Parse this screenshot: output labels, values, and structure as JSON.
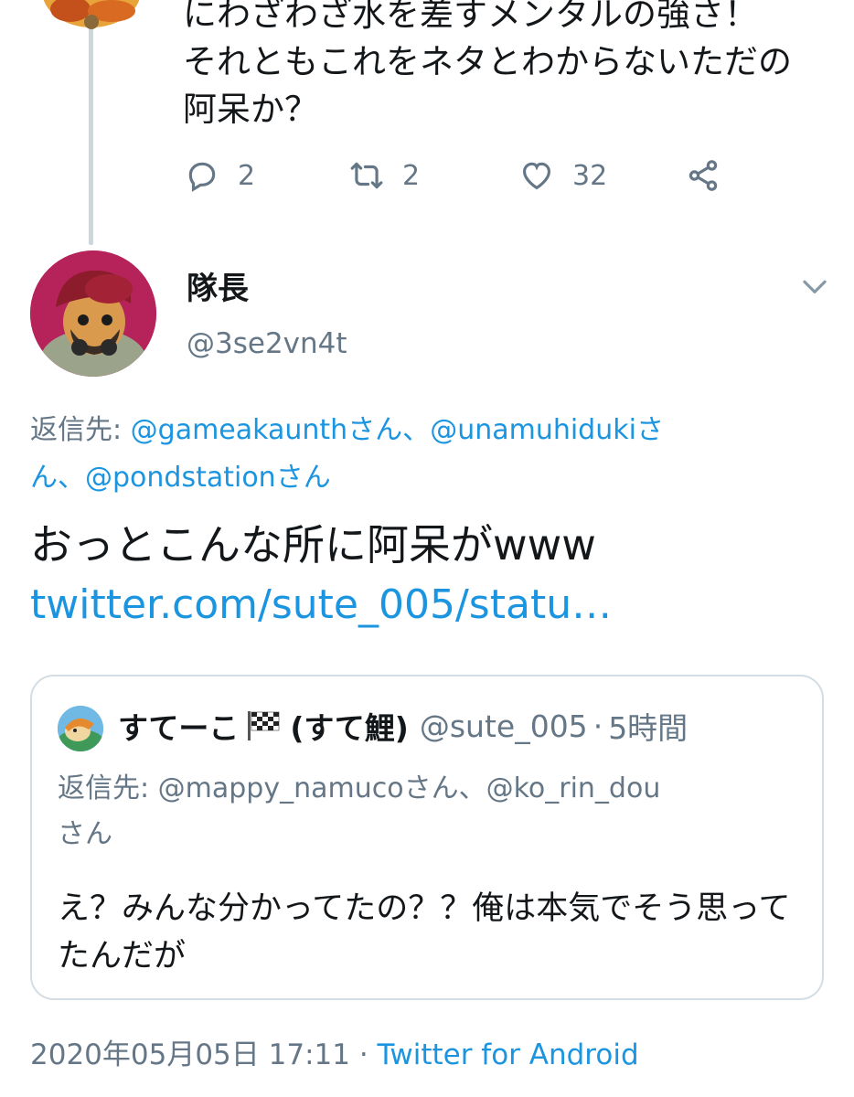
{
  "prev_tweet": {
    "text_lines": [
      "にわざわざ水を差すメンタルの強さ！",
      "それともこれをネタとわからないただの",
      "阿呆か？"
    ],
    "actions": {
      "reply_count": "2",
      "retweet_count": "2",
      "like_count": "32"
    }
  },
  "tweet": {
    "display_name": "隊長",
    "handle": "@3se2vn4t",
    "reply_to": {
      "prefix": "返信先: ",
      "line1_mentions": [
        {
          "user": "@gameakaunth",
          "suffix": "さん、"
        },
        {
          "user": "@unamuhiduki",
          "suffix": "さ"
        }
      ],
      "line2_prefix": "ん、",
      "line2_user": "@pondstation",
      "line2_suffix": "さん"
    },
    "text": "おっとこんな所に阿呆がwww",
    "url": "twitter.com/sute_005/statu…",
    "timestamp": "2020年05月05日 17:11",
    "separator": " · ",
    "client": "Twitter for Android"
  },
  "quoted": {
    "display_name": "すてーこ",
    "name_suffix": "(すて鯉)",
    "handle": "@sute_005",
    "time_ago": "5時間",
    "reply_prefix": "返信先: ",
    "reply_user1": "@mappy_namuco",
    "reply_mid": "さん、",
    "reply_user2": "@ko_rin_dou",
    "reply_end": "さん",
    "text": "え？みんな分かってたの？？俺は本気でそう思ってたんだが"
  },
  "colors": {
    "link": "#1b95e0",
    "secondary_text": "#657786",
    "primary_text": "#14171a",
    "thread_line": "#ccd6dd"
  }
}
